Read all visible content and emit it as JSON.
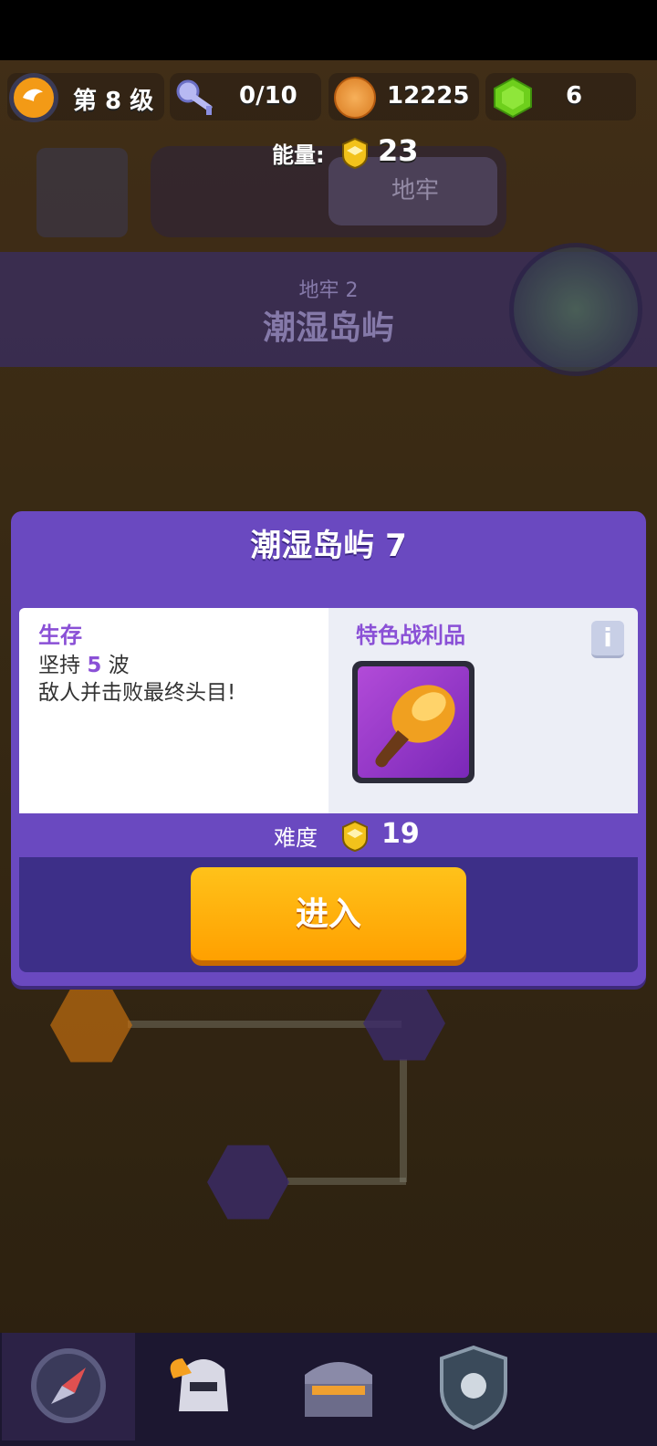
{
  "header": {
    "level_label": "第 8 级",
    "keys": "0/10",
    "coins": "12225",
    "gems": "6",
    "energy_label": "能量:",
    "energy_value": "23"
  },
  "background": {
    "mode_tab_selected": "地牢",
    "dungeon_subtitle": "地牢 2",
    "dungeon_name": "潮湿岛屿"
  },
  "dialog": {
    "title": "潮湿岛屿 7",
    "objective_heading": "生存",
    "objective_prefix": "坚持",
    "objective_waves": "5",
    "objective_suffix": "波",
    "objective_line2": "敌人并击败最终头目!",
    "loot_heading": "特色战利品",
    "info_label": "i",
    "difficulty_label": "难度",
    "difficulty_value": "19",
    "enter_label": "进入"
  },
  "icons": {
    "level": "level-ring-icon",
    "keys": "key-icon",
    "coins": "coin-icon",
    "gems": "gem-icon",
    "energy": "energy-shield-icon",
    "loot": "drumstick-icon",
    "nav": [
      "compass-icon",
      "helmet-icon",
      "chest-icon",
      "shield-badge-icon"
    ]
  },
  "colors": {
    "accent_purple": "#6a49c0",
    "button_orange": "#ffa000",
    "gem_green": "#6ecf1c"
  }
}
